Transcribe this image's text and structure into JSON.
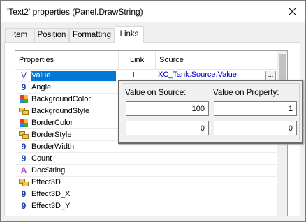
{
  "window": {
    "title": "'Text2' properties (Panel.DrawString)"
  },
  "tabs": [
    {
      "label": "Item"
    },
    {
      "label": "Position"
    },
    {
      "label": "Formatting"
    },
    {
      "label": "Links",
      "active": true
    }
  ],
  "grid": {
    "columns": [
      "Properties",
      "Link",
      "Source"
    ],
    "rows": [
      {
        "icon": "value-icon",
        "name": "Value",
        "selected": true,
        "link": "I",
        "source": "XC_Tank.Source.Value"
      },
      {
        "icon": "number-icon",
        "name": "Angle"
      },
      {
        "icon": "color-icon",
        "name": "BackgroundColor"
      },
      {
        "icon": "style-icon",
        "name": "BackgroundStyle"
      },
      {
        "icon": "color-icon",
        "name": "BorderColor"
      },
      {
        "icon": "style-icon",
        "name": "BorderStyle"
      },
      {
        "icon": "number-icon",
        "name": "BorderWidth"
      },
      {
        "icon": "number-icon",
        "name": "Count"
      },
      {
        "icon": "text-icon",
        "name": "DocString"
      },
      {
        "icon": "style-icon",
        "name": "Effect3D"
      },
      {
        "icon": "number-icon",
        "name": "Effect3D_X"
      },
      {
        "icon": "number-icon",
        "name": "Effect3D_Y"
      }
    ],
    "ellipsis": "..."
  },
  "popup": {
    "source_label": "Value on Source:",
    "property_label": "Value on Property:",
    "source_values": [
      "100",
      "0"
    ],
    "property_values": [
      "1",
      "0"
    ]
  },
  "icons": {
    "value-icon": "V",
    "number-icon": "9",
    "text-icon": "A"
  },
  "colors": {
    "selection": "#0078d7",
    "source_link_text": "#0000cc"
  }
}
